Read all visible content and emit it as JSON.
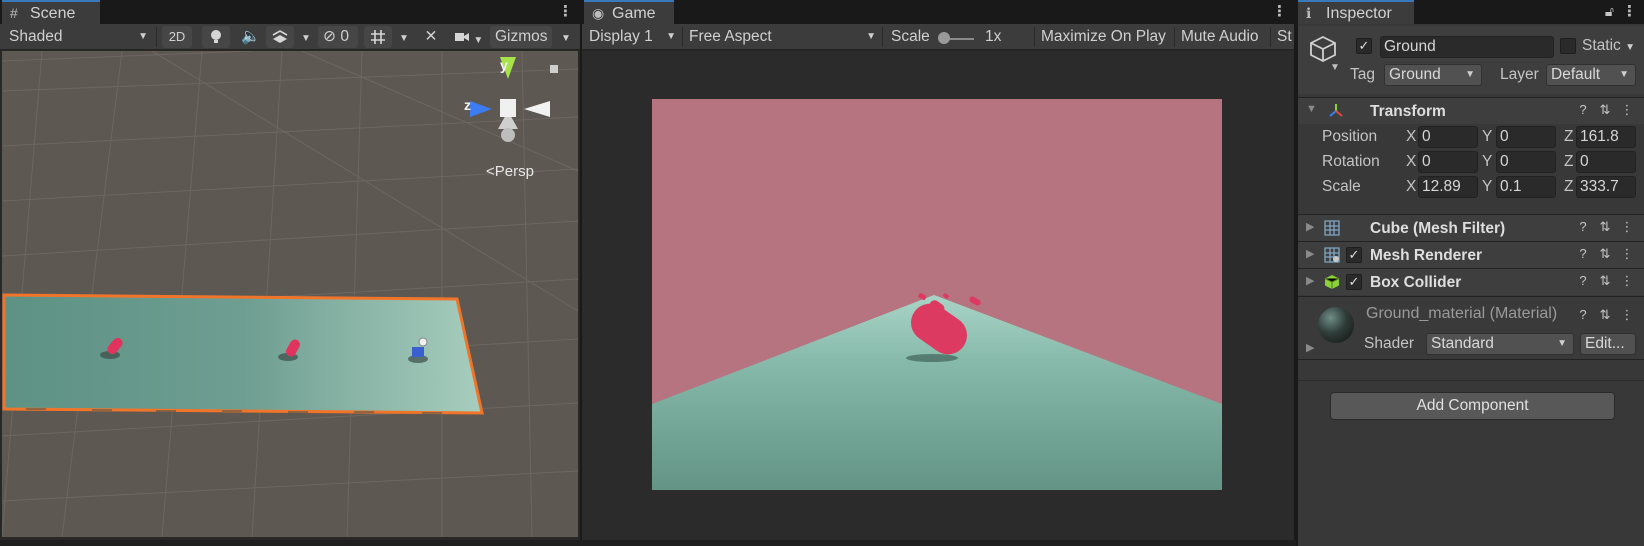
{
  "scene": {
    "tab_label": "Scene",
    "shading_mode": "Shaded",
    "btn_2d": "2D",
    "hidden_count": "0",
    "gizmos_label": "Gizmos",
    "gizmo_axis_y": "y",
    "gizmo_axis_z": "z",
    "persp_label": "Persp"
  },
  "game": {
    "tab_label": "Game",
    "display": "Display 1",
    "aspect": "Free Aspect",
    "scale_label": "Scale",
    "scale_value": "1x",
    "maximize_label": "Maximize On Play",
    "mute_label": "Mute Audio",
    "stats_label": "St",
    "sky_color": "#b57480",
    "ground_color": "#7fb3a5"
  },
  "inspector": {
    "tab_label": "Inspector",
    "object_name": "Ground",
    "static_label": "Static",
    "tag_label": "Tag",
    "tag_value": "Ground",
    "layer_label": "Layer",
    "layer_value": "Default",
    "transform": {
      "title": "Transform",
      "position_label": "Position",
      "rotation_label": "Rotation",
      "scale_label": "Scale",
      "x": "X",
      "y": "Y",
      "z": "Z",
      "position": {
        "x": "0",
        "y": "0",
        "z": "161.8"
      },
      "rotation": {
        "x": "0",
        "y": "0",
        "z": "0"
      },
      "scale": {
        "x": "12.89",
        "y": "0.1",
        "z": "333.7"
      }
    },
    "components": [
      {
        "title": "Cube (Mesh Filter)",
        "icon": "grid-icon"
      },
      {
        "title": "Mesh Renderer",
        "icon": "mesh-renderer-icon"
      },
      {
        "title": "Box Collider",
        "icon": "cube-green-icon"
      }
    ],
    "material_name": "Ground_material (Material)",
    "shader_label": "Shader",
    "shader_value": "Standard",
    "edit_label": "Edit...",
    "add_component_label": "Add Component"
  }
}
